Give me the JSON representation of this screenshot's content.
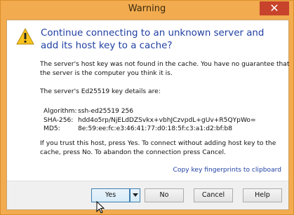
{
  "window": {
    "title": "Warning",
    "close_label": "✕"
  },
  "dialog": {
    "heading": "Continue connecting to an unknown server and add its host key to a cache?",
    "paragraph1_line1": "The server's host key was not found in the cache. You have no guarantee that",
    "paragraph1_line2": "the server is the computer you think it is.",
    "paragraph2": "The server's Ed25519 key details are:",
    "keys": [
      {
        "label": "Algorithm:",
        "value": "ssh-ed25519 256"
      },
      {
        "label": "SHA-256:",
        "value": "hdd4o5rp/NjELdDZSvkx+vbhJCzvpdL+gUv+R5QYpWo="
      },
      {
        "label": "MD5:",
        "value": "8e:59:ee:fc:e3:46:41:77:d0:18:5f:c3:a1:d2:bf:b8"
      }
    ],
    "paragraph3_line1": "If you trust this host, press Yes. To connect without adding host key to the",
    "paragraph3_line2": "cache, press No. To abandon the connection press Cancel.",
    "copy_link": "Copy key fingerprints to clipboard"
  },
  "buttons": {
    "yes": "Yes",
    "yes_dropdown_icon": "triangle-down",
    "no": "No",
    "cancel": "Cancel",
    "help": "Help"
  },
  "colors": {
    "title_bar": "#f2ab4e",
    "heading": "#1f3fa2",
    "close_button": "#c7432b"
  },
  "icons": {
    "warning": "warning-triangle-icon",
    "cursor": "mouse-pointer-icon"
  }
}
